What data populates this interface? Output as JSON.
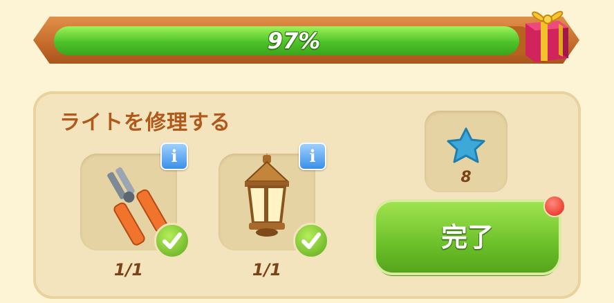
{
  "progress": {
    "percent_label": "97%",
    "value": 0.97
  },
  "task": {
    "title": "ライトを修理する",
    "items": [
      {
        "icon": "pliers-icon",
        "count_label": "1/1",
        "info_label": "i"
      },
      {
        "icon": "lantern-icon",
        "count_label": "1/1",
        "info_label": "i"
      }
    ],
    "reward": {
      "icon": "blue-star-icon",
      "count_label": "8"
    },
    "complete_label": "完了"
  },
  "colors": {
    "progress_green": "#4ec22a",
    "frame_orange": "#c46a2a",
    "title_brown": "#b0591a",
    "button_green": "#6cc02a",
    "notify_red": "#e32417",
    "info_blue": "#3b8fe6"
  }
}
